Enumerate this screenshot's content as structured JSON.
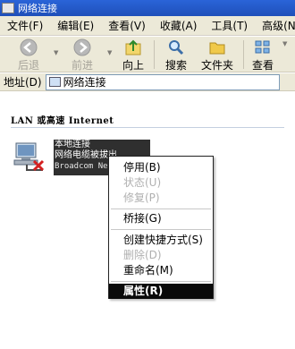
{
  "window": {
    "title": "网络连接"
  },
  "menu": [
    "文件(F)",
    "编辑(E)",
    "查看(V)",
    "收藏(A)",
    "工具(T)",
    "高级(N)"
  ],
  "toolbar": {
    "back": "后退",
    "forward": "前进",
    "up": "向上",
    "search": "搜索",
    "folders": "文件夹",
    "views": "查看"
  },
  "address": {
    "label": "地址(D)",
    "value": "网络连接"
  },
  "group": {
    "header": "LAN 或高速 Internet"
  },
  "connection": {
    "name": "本地连接",
    "status": "网络电缆被拔出",
    "device": "Broadcom Ne"
  },
  "context_menu": {
    "disable": "停用(B)",
    "status": "状态(U)",
    "repair": "修复(P)",
    "bridge": "桥接(G)",
    "create_shortcut": "创建快捷方式(S)",
    "delete": "删除(D)",
    "rename": "重命名(M)",
    "properties": "属性(R)"
  },
  "colors": {
    "titlebar": "#2a64d8",
    "menu_bg": "#ece9d8",
    "selection": "#0a0a0a"
  }
}
